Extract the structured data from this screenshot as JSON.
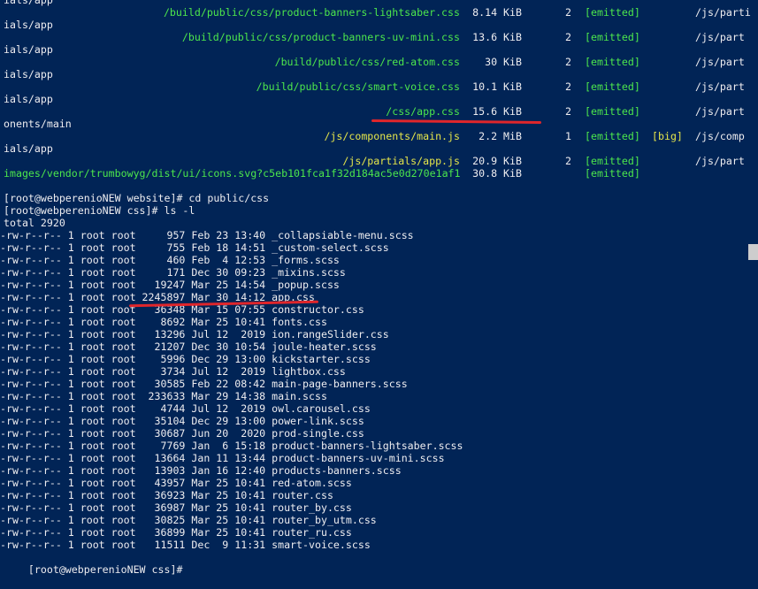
{
  "webpack_rows": [
    {
      "wrap": "ials/app",
      "asset": "/build/public/css/product-banners-lightsaber.css",
      "size": "8.14 KiB",
      "chunks": "2",
      "status": "[emitted]",
      "tag": "",
      "names": "/js/parti"
    },
    {
      "wrap": "ials/app",
      "asset": "/build/public/css/product-banners-uv-mini.css",
      "size": "13.6 KiB",
      "chunks": "2",
      "status": "[emitted]",
      "tag": "",
      "names": "/js/part"
    },
    {
      "wrap": "ials/app",
      "asset": "/build/public/css/red-atom.css",
      "size": "30 KiB",
      "chunks": "2",
      "status": "[emitted]",
      "tag": "",
      "names": "/js/part"
    },
    {
      "wrap": "ials/app",
      "asset": "/build/public/css/smart-voice.css",
      "size": "10.1 KiB",
      "chunks": "2",
      "status": "[emitted]",
      "tag": "",
      "names": "/js/part"
    },
    {
      "wrap": "ials/app",
      "asset": "/css/app.css",
      "size": "15.6 KiB",
      "chunks": "2",
      "status": "[emitted]",
      "tag": "",
      "names": "/js/part"
    },
    {
      "wrap": "onents/main",
      "asset": "/js/components/main.js",
      "size": "2.2 MiB",
      "chunks": "1",
      "status": "[emitted]",
      "tag": "[big]",
      "names": "/js/comp"
    },
    {
      "wrap": "ials/app",
      "asset": "/js/partials/app.js",
      "size": "20.9 KiB",
      "chunks": "2",
      "status": "[emitted]",
      "tag": "",
      "names": "/js/part"
    },
    {
      "wrap": "",
      "asset": "images/vendor/trumbowyg/dist/ui/icons.svg?c5eb101fca1f32d184ac5e0d270e1af1",
      "size": "30.8 KiB",
      "chunks": "",
      "status": "[emitted]",
      "tag": "",
      "names": ""
    }
  ],
  "commands": {
    "cd_prompt": "[root@webperenioNEW website]# cd public/css",
    "ls_prompt": "[root@webperenioNEW css]# ls -l",
    "total": "total 2920",
    "final_prompt": "[root@webperenioNEW css]# "
  },
  "files": [
    "-rw-r--r-- 1 root root     957 Feb 23 13:40 _collapsiable-menu.scss",
    "-rw-r--r-- 1 root root     755 Feb 18 14:51 _custom-select.scss",
    "-rw-r--r-- 1 root root     460 Feb  4 12:53 _forms.scss",
    "-rw-r--r-- 1 root root     171 Dec 30 09:23 _mixins.scss",
    "-rw-r--r-- 1 root root   19247 Mar 25 14:54 _popup.scss",
    "-rw-r--r-- 1 root root 2245897 Mar 30 14:12 app.css",
    "-rw-r--r-- 1 root root   36348 Mar 15 07:55 constructor.css",
    "-rw-r--r-- 1 root root    8692 Mar 25 10:41 fonts.css",
    "-rw-r--r-- 1 root root   13296 Jul 12  2019 ion.rangeSlider.css",
    "-rw-r--r-- 1 root root   21207 Dec 30 10:54 joule-heater.scss",
    "-rw-r--r-- 1 root root    5996 Dec 29 13:00 kickstarter.scss",
    "-rw-r--r-- 1 root root    3734 Jul 12  2019 lightbox.css",
    "-rw-r--r-- 1 root root   30585 Feb 22 08:42 main-page-banners.scss",
    "-rw-r--r-- 1 root root  233633 Mar 29 14:38 main.scss",
    "-rw-r--r-- 1 root root    4744 Jul 12  2019 owl.carousel.css",
    "-rw-r--r-- 1 root root   35104 Dec 29 13:00 power-link.scss",
    "-rw-r--r-- 1 root root   30687 Jun 20  2020 prod-single.css",
    "-rw-r--r-- 1 root root    7769 Jan  6 15:18 product-banners-lightsaber.scss",
    "-rw-r--r-- 1 root root   13664 Jan 11 13:44 product-banners-uv-mini.scss",
    "-rw-r--r-- 1 root root   13903 Jan 16 12:40 products-banners.scss",
    "-rw-r--r-- 1 root root   43957 Mar 25 10:41 red-atom.scss",
    "-rw-r--r-- 1 root root   36923 Mar 25 10:41 router.css",
    "-rw-r--r-- 1 root root   36987 Mar 25 10:41 router_by.css",
    "-rw-r--r-- 1 root root   30825 Mar 25 10:41 router_by_utm.css",
    "-rw-r--r-- 1 root root   36899 Mar 25 10:41 router_ru.css",
    "-rw-r--r-- 1 root root   11511 Dec  9 11:31 smart-voice.scss"
  ],
  "colors": {
    "background": "#012456",
    "text": "#eeedf0",
    "asset_green": "#4ce64c",
    "asset_yellow": "#e5e54a",
    "highlight_red": "#e0262b"
  }
}
